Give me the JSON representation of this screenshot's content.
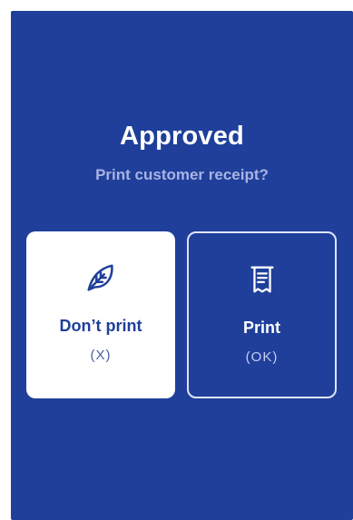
{
  "dialog": {
    "title": "Approved",
    "subtitle": "Print customer receipt?"
  },
  "options": [
    {
      "label": "Don’t print",
      "key": "(X)",
      "icon": "leaf-icon",
      "selected": true
    },
    {
      "label": "Print",
      "key": "(OK)",
      "icon": "receipt-icon",
      "selected": false
    }
  ],
  "colors": {
    "background": "#1f3f9a",
    "title": "#ffffff",
    "subtitle": "#a9b3e3",
    "selected_card": "#ffffff",
    "card_border": "#dfe5fb"
  }
}
